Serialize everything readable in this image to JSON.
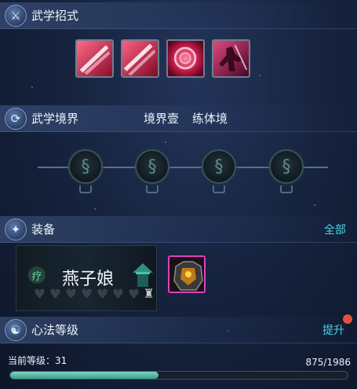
{
  "skills_section": {
    "title": "武学招式",
    "icon": "sword-icon",
    "skills": [
      {
        "name": "slash-skill-1",
        "color": "#d2204a"
      },
      {
        "name": "slash-skill-2",
        "color": "#d2204a"
      },
      {
        "name": "rose-spin-skill",
        "color": "#c8184a"
      },
      {
        "name": "warrior-skill",
        "color": "#b01a52"
      }
    ]
  },
  "realm_section": {
    "title": "武学境界",
    "realm_name": "境界壹",
    "realm_level": "练体境",
    "icon": "swirl-icon",
    "nodes": 4
  },
  "equip_section": {
    "title": "装备",
    "icon": "armor-icon",
    "link": "全部",
    "card": {
      "kind_glyph": "疗",
      "name": "燕子娘",
      "hearts_total": 7,
      "hearts_filled": 0
    }
  },
  "heart_method_section": {
    "title": "心法等级",
    "icon": "meditate-icon",
    "action": "提升",
    "level_label": "当前等级：31",
    "progress_text": "875/1986",
    "progress_fraction": 0.4406
  },
  "colors": {
    "accent_link": "#4fd0e6",
    "progress_fill": "#4fb39c",
    "notify": "#e0523c",
    "rare_border": "#e040c0"
  }
}
